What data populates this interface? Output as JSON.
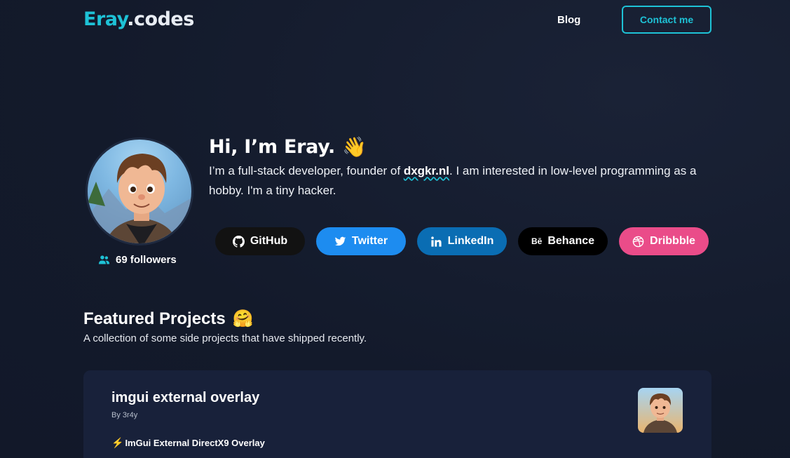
{
  "header": {
    "logo_brand": "Eray",
    "logo_tld": ".codes",
    "nav_blog": "Blog",
    "contact_label": "Contact me"
  },
  "profile": {
    "followers_label": "69 followers",
    "avatar_icon": "avatar-portrait"
  },
  "hero": {
    "title": "Hi, I’m Eray.",
    "title_emoji": "👋",
    "desc_before": "I’m a full-stack developer, founder of ",
    "desc_link": "dxgkr.nl",
    "desc_after": ". I am interested in low-level programming as a hobby. I'm a tiny hacker."
  },
  "socials": [
    {
      "label": "GitHub",
      "icon": "github-icon",
      "color": "#121212"
    },
    {
      "label": "Twitter",
      "icon": "twitter-icon",
      "color": "#1d8cf0"
    },
    {
      "label": "LinkedIn",
      "icon": "linkedin-icon",
      "color": "#0a6db3"
    },
    {
      "label": "Behance",
      "icon": "behance-icon",
      "color": "#000000"
    },
    {
      "label": "Dribbble",
      "icon": "dribbble-icon",
      "color": "#ea4c89"
    }
  ],
  "featured": {
    "title": "Featured Projects",
    "title_emoji": "🤗",
    "subtitle": "A collection of some side projects that have shipped recently."
  },
  "projects": [
    {
      "name": "imgui external overlay",
      "author": "By 3r4y",
      "desc_emoji": "⚡",
      "desc": "ImGui External DirectX9 Overlay"
    }
  ],
  "colors": {
    "accent": "#1ec2d6",
    "background": "#141c2f",
    "card": "#18213a"
  }
}
